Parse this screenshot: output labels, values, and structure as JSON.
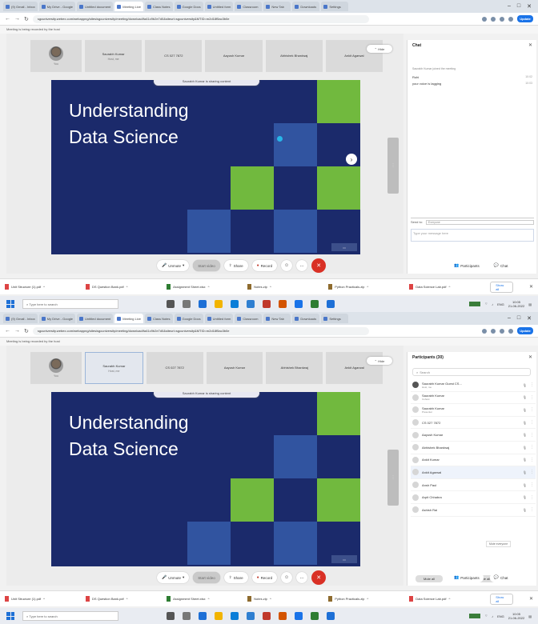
{
  "browser": {
    "tabs": [
      "(9) Gmail - Inbox",
      "My Drive - Google",
      "Untitled document",
      "Meeting Live",
      "Class Notes",
      "Google Docs",
      "Untitled form",
      "Classroom",
      "New Tab",
      "Downloads",
      "Settings"
    ],
    "active_tab_index": 3,
    "url": "sgcuniversity.webex.com/webappng/sites/sgcuniversity/meeting/download/fa41c9b2e7d0&siteurl=sgcuniversity&MTID=m2d18f5ac3b0e",
    "update_label": "Update",
    "banner": "Meeting is being recorded by the host"
  },
  "meeting": {
    "self_tile_name": "You",
    "tiles": [
      {
        "name": "Saurabh Kumar",
        "sub": "Host, me"
      },
      {
        "name": "CS 027 7872",
        "sub": ""
      },
      {
        "name": "Aayush Kumar",
        "sub": ""
      },
      {
        "name": "Abhishek Bhardwaj",
        "sub": ""
      },
      {
        "name": "Ankit Agarwal",
        "sub": ""
      }
    ],
    "hide_label": "Hide",
    "share_pill": "Saurabh Kumar is sharing content",
    "slide": {
      "title_line1": "Understanding",
      "title_line2": "Data Science"
    },
    "toolbar": {
      "mute": "Unmute",
      "video": "Start video",
      "share": "Share",
      "record": "Record",
      "more": "...",
      "leave": "✕"
    },
    "panel_buttons": {
      "participants": "Participants",
      "chat": "Chat"
    }
  },
  "chat_panel": {
    "title": "Chat",
    "notice": "Saurabh Kumar joined the meeting",
    "messages": [
      {
        "from": "Ruhi",
        "time": "10:02"
      },
      {
        "from": "your voice is lagging",
        "time": "10:03"
      }
    ],
    "send_to_label": "Send to:",
    "send_to_value": "Everyone",
    "input_placeholder": "Type your message here"
  },
  "participants_panel": {
    "title": "Participants (30)",
    "search_placeholder": "Search",
    "tooltip": "Mute everyone",
    "items": [
      {
        "name": "Saurabh Kumar Guest CS...",
        "role": "Host, me",
        "me": true
      },
      {
        "name": "Saurabh Kumar",
        "role": "Cohost",
        "me": false
      },
      {
        "name": "Saurabh Kumar",
        "role": "Presenter",
        "me": false
      },
      {
        "name": "CS 027 7872",
        "role": "",
        "me": false
      },
      {
        "name": "Aayush Kumar",
        "role": "",
        "me": false
      },
      {
        "name": "Abhishek Bhardwaj",
        "role": "",
        "me": false
      },
      {
        "name": "Ankit Kumar",
        "role": "",
        "me": false
      },
      {
        "name": "Ankit Agarwal",
        "role": "",
        "me": false
      },
      {
        "name": "Ansh Paul",
        "role": "",
        "me": false
      },
      {
        "name": "Arpit Chhabra",
        "role": "",
        "me": false
      },
      {
        "name": "Ashish Rai",
        "role": "",
        "me": false
      }
    ],
    "mute_all": "Mute all",
    "unmute_all": "Unmute all"
  },
  "downloads": [
    {
      "name": "Unit Structure (1).pdf",
      "kind": "pdf"
    },
    {
      "name": "DS Question Bank.pdf",
      "kind": "pdf"
    },
    {
      "name": "Assignment Sheet.xlsx",
      "kind": "xl"
    },
    {
      "name": "Notes.zip",
      "kind": "zp"
    },
    {
      "name": "Python Practicals.zip",
      "kind": "zp"
    },
    {
      "name": "Data Science Lab.pdf",
      "kind": "pdf"
    }
  ],
  "show_all": "Show all",
  "taskbar": {
    "search_placeholder": "Type here to search",
    "time": "10:05",
    "date": "21-06-2022",
    "lang": "ENG"
  }
}
